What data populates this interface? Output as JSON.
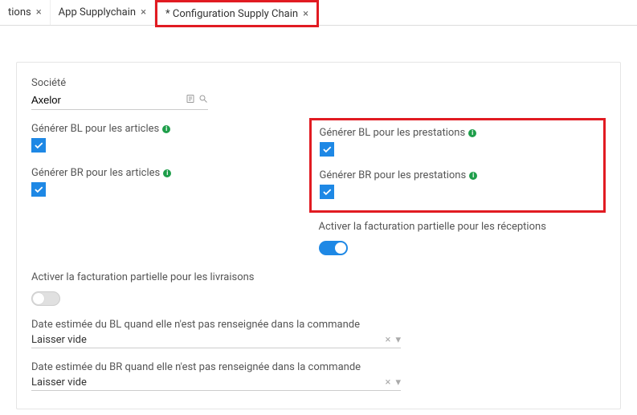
{
  "tabs": [
    {
      "label": "tions",
      "partial": true
    },
    {
      "label": "App Supplychain"
    },
    {
      "label": "* Configuration Supply Chain",
      "highlight": true
    }
  ],
  "form": {
    "company": {
      "label": "Société",
      "value": "Axelor"
    },
    "gen_bl_articles": {
      "label": "Générer BL pour les articles",
      "checked": true
    },
    "gen_br_articles": {
      "label": "Générer BR pour les articles",
      "checked": true
    },
    "gen_bl_prestations": {
      "label": "Générer BL pour les prestations",
      "checked": true
    },
    "gen_br_prestations": {
      "label": "Générer BR pour les prestations",
      "checked": true
    },
    "partial_invoice_receptions": {
      "label": "Activer la facturation partielle pour les réceptions",
      "on": true
    },
    "partial_invoice_deliveries": {
      "label": "Activer la facturation partielle pour les livraisons",
      "on": false
    },
    "est_date_bl": {
      "label": "Date estimée du BL quand elle n'est pas renseignée dans la commande",
      "value": "Laisser vide"
    },
    "est_date_br": {
      "label": "Date estimée du BR quand elle n'est pas renseignée dans la commande",
      "value": "Laisser vide"
    }
  }
}
